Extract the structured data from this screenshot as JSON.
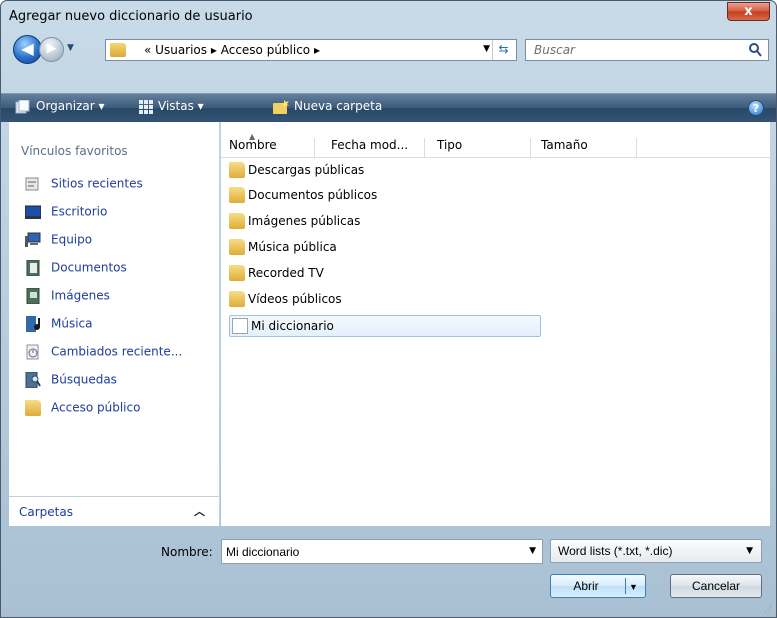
{
  "window": {
    "title": "Agregar nuevo diccionario de usuario",
    "close_label": "x"
  },
  "address": {
    "prefix": "«",
    "crumbs": [
      "Usuarios",
      "Acceso público"
    ],
    "separator": "▸",
    "search_placeholder": "Buscar"
  },
  "toolbar": {
    "organize": "Organizar",
    "views": "Vistas",
    "new_folder": "Nueva carpeta",
    "help": "?"
  },
  "sidebar": {
    "header": "Vínculos favoritos",
    "items": [
      {
        "label": "Sitios recientes",
        "icon": "recent-sites-icon"
      },
      {
        "label": "Escritorio",
        "icon": "desktop-icon"
      },
      {
        "label": "Equipo",
        "icon": "computer-icon"
      },
      {
        "label": "Documentos",
        "icon": "documents-icon"
      },
      {
        "label": "Imágenes",
        "icon": "pictures-icon"
      },
      {
        "label": "Música",
        "icon": "music-icon"
      },
      {
        "label": "Cambiados reciente...",
        "icon": "recently-changed-icon"
      },
      {
        "label": "Búsquedas",
        "icon": "searches-icon"
      },
      {
        "label": "Acceso público",
        "icon": "folder-icon"
      }
    ],
    "folders_label": "Carpetas"
  },
  "columns": [
    "Nombre",
    "Fecha mod...",
    "Tipo",
    "Tamaño"
  ],
  "files": [
    {
      "name": "Descargas públicas",
      "icon": "folder-icon"
    },
    {
      "name": "Documentos públicos",
      "icon": "documents-folder-icon"
    },
    {
      "name": "Imágenes públicas",
      "icon": "pictures-folder-icon"
    },
    {
      "name": "Música pública",
      "icon": "music-folder-icon"
    },
    {
      "name": "Recorded TV",
      "icon": "folder-icon"
    },
    {
      "name": "Vídeos públicos",
      "icon": "videos-folder-icon"
    },
    {
      "name": "Mi diccionario",
      "icon": "document-icon",
      "selected": true
    }
  ],
  "bottom": {
    "name_label": "Nombre:",
    "name_value": "Mi diccionario",
    "filter_value": "Word lists (*.txt, *.dic)",
    "open_label": "Abrir",
    "cancel_label": "Cancelar"
  },
  "colors": {
    "link": "#1c3d9c",
    "toolbar": "#335476",
    "selection": "#e4f0fb"
  }
}
